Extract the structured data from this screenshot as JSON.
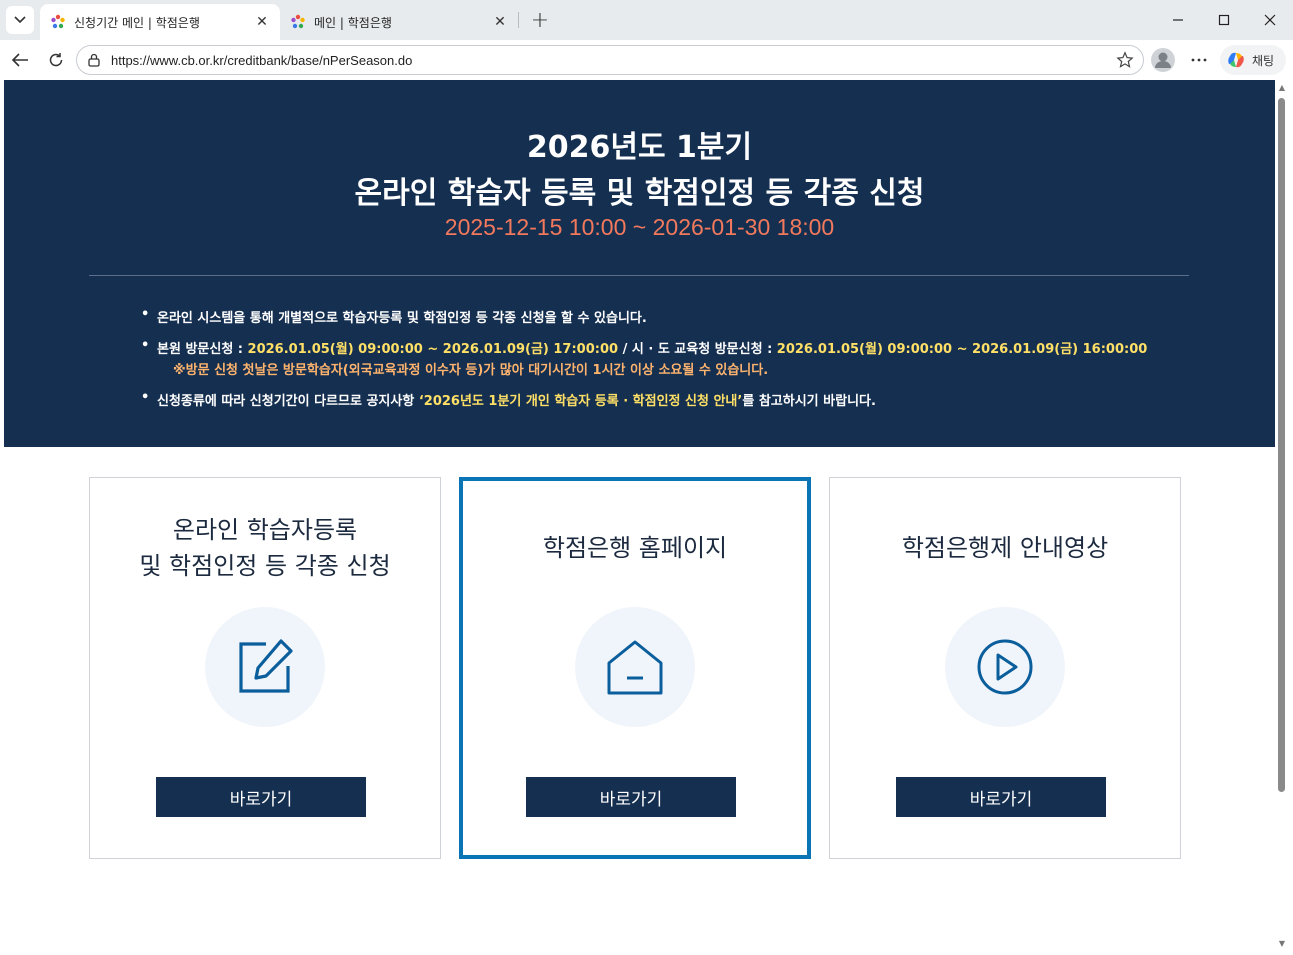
{
  "browser": {
    "tabs": [
      {
        "title": "신청기간 메인 | 학점은행",
        "active": true
      },
      {
        "title": "메인 | 학점은행",
        "active": false
      }
    ],
    "url": "https://www.cb.or.kr/creditbank/base/nPerSeason.do",
    "copilot_label": "채팅"
  },
  "hero": {
    "title_line1": "2026년도 1분기",
    "title_line2": "온라인 학습자 등록 및 학점인정 등 각종 신청",
    "period": "2025-12-15 10:00 ~ 2026-01-30 18:00",
    "notices": {
      "n1": "온라인 시스템을 통해 개별적으로 학습자등록 및 학점인정 등 각종 신청을 할 수 있습니다.",
      "n2_label1": "본원 방문신청 : ",
      "n2_period1": "2026.01.05(월) 09:00:00 ~ 2026.01.09(금) 17:00:00",
      "n2_label2": " / 시 · 도 교육청 방문신청 : ",
      "n2_period2": "2026.01.05(월) 09:00:00 ~ 2026.01.09(금) 16:00:00",
      "n2_sub": "※방문 신청 첫날은 방문학습자(외국교육과정 이수자 등)가 많아 대기시간이 1시간 이상 소요될 수 있습니다.",
      "n3_pre": "신청종류에 따라 신청기간이 다르므로 공지사항 ",
      "n3_highlight": "‘2026년도 1분기 개인 학습자 등록 · 학점인정 신청 안내’",
      "n3_post": "를 참고하시기 바랍니다."
    }
  },
  "cards": [
    {
      "title_line1": "온라인 학습자등록",
      "title_line2": "및 학점인정 등 각종 신청",
      "icon": "edit-icon",
      "button": "바로가기"
    },
    {
      "title": "학점은행 홈페이지",
      "icon": "home-icon",
      "button": "바로가기"
    },
    {
      "title": "학점은행제 안내영상",
      "icon": "play-icon",
      "button": "바로가기"
    }
  ],
  "colors": {
    "navy": "#152f51",
    "period_red": "#f2795c",
    "highlight_yellow": "#ffe066",
    "sub_orange": "#ffb46e",
    "selected_border": "#0b74b5"
  }
}
